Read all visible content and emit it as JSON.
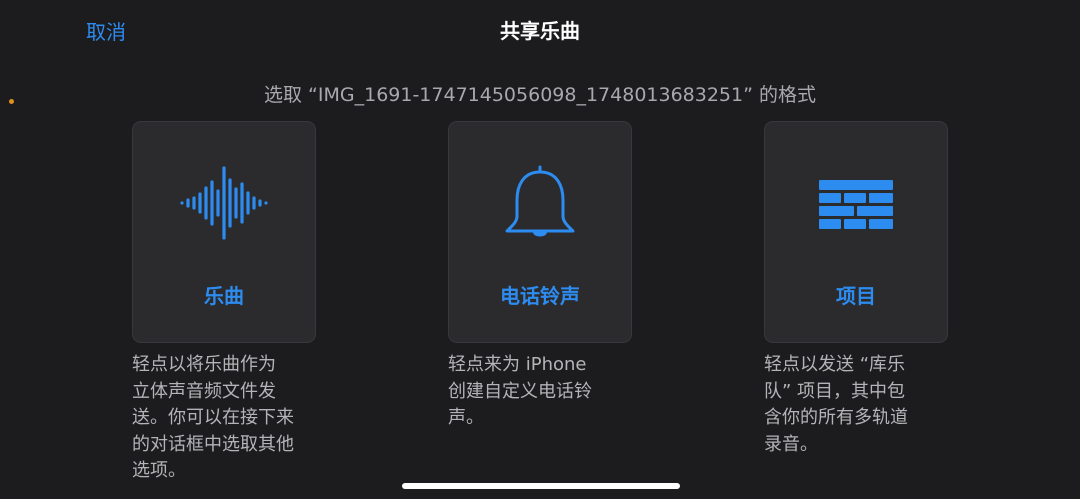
{
  "colors": {
    "accent": "#2d8cf0",
    "indicator": "#e0901c"
  },
  "header": {
    "cancel_label": "取消",
    "title": "共享乐曲"
  },
  "prompt": "选取 “IMG_1691-1747145056098_1748013683251” 的格式",
  "options": [
    {
      "icon": "waveform-icon",
      "label": "乐曲",
      "description": "轻点以将乐曲作为\n立体声音频文件发\n送。你可以在接下来\n的对话框中选取其他\n选项。"
    },
    {
      "icon": "bell-icon",
      "label": "电话铃声",
      "description": "轻点来为 iPhone\n创建自定义电话铃\n声。"
    },
    {
      "icon": "bricks-icon",
      "label": "项目",
      "description": "轻点以发送 “库乐\n队” 项目，其中包\n含你的所有多轨道\n录音。"
    }
  ]
}
